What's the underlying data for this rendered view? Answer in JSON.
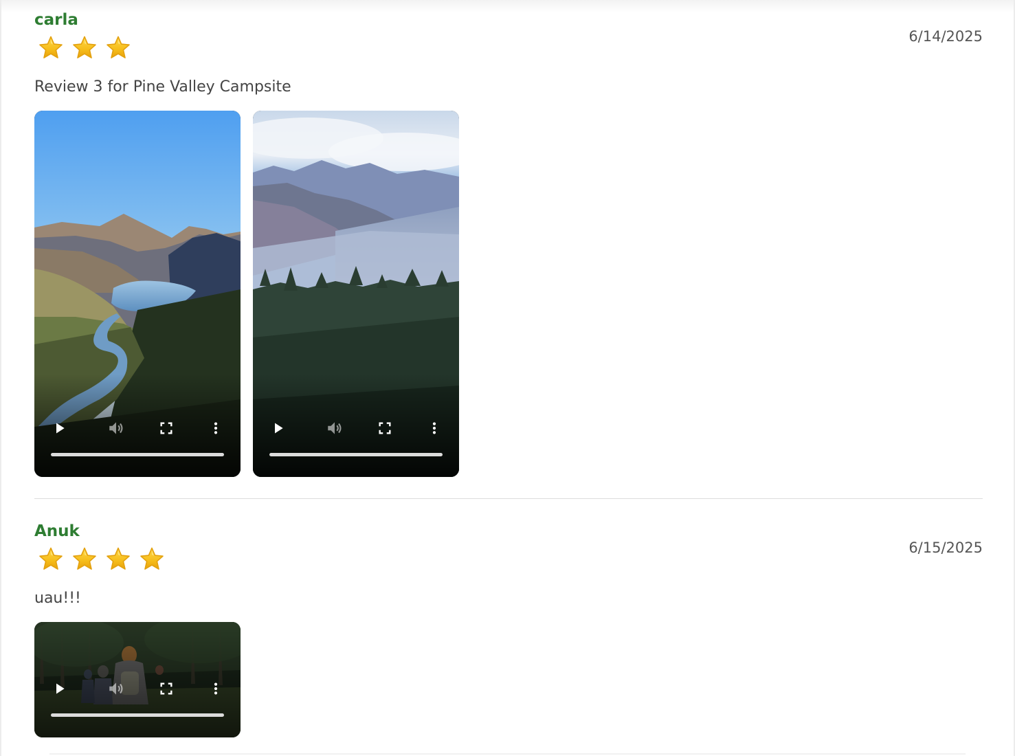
{
  "reviews": [
    {
      "author": "carla",
      "rating": 3,
      "date": "6/14/2025",
      "comment": "Review 3 for Pine Valley Campsite",
      "videos": [
        {
          "scene": "mountain-lake-valley"
        },
        {
          "scene": "misty-forest-mountains"
        }
      ]
    },
    {
      "author": "Anuk",
      "rating": 4,
      "date": "6/15/2025",
      "comment": "uau!!!",
      "videos": [
        {
          "scene": "hikers-in-forest"
        }
      ]
    }
  ],
  "icons": {
    "star": "star-icon",
    "play": "play-icon",
    "volume": "volume-icon",
    "fullscreen": "fullscreen-icon",
    "more": "more-vertical-icon"
  },
  "colors": {
    "author": "#2e7d32",
    "star_fill": "#f4c020",
    "date": "#555555",
    "comment": "#444444"
  }
}
